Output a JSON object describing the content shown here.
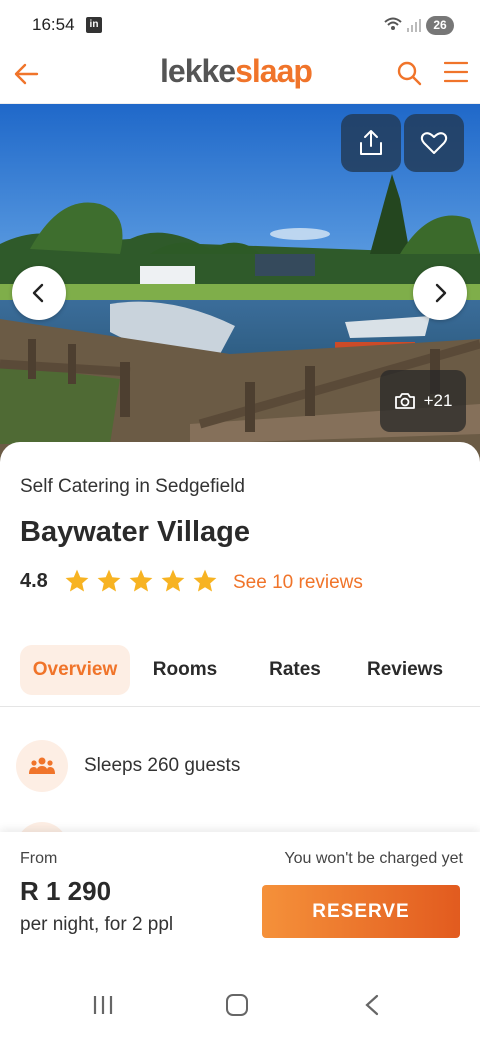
{
  "status_bar": {
    "time": "16:54",
    "notification_icon": "linkedin-icon",
    "battery": "26"
  },
  "header": {
    "logo_part1": "lekke",
    "logo_part2": "slaap",
    "back_icon": "arrow-left-icon",
    "search_icon": "search-icon",
    "menu_icon": "hamburger-menu-icon"
  },
  "hero": {
    "photo_count": "+21",
    "share_icon": "share-icon",
    "favorite_icon": "heart-icon"
  },
  "listing": {
    "category": "Self Catering in Sedgefield",
    "title": "Baywater Village",
    "rating": "4.8",
    "stars": 5,
    "reviews_link": "See 10 reviews"
  },
  "tabs": [
    {
      "label": "Overview",
      "active": true
    },
    {
      "label": "Rooms",
      "active": false
    },
    {
      "label": "Rates",
      "active": false
    },
    {
      "label": "Reviews",
      "active": false
    }
  ],
  "features": [
    {
      "icon": "people-icon",
      "label": "Sleeps 260 guests"
    }
  ],
  "booking": {
    "from_label": "From",
    "price": "R 1 290",
    "per_night": "per night, for 2 ppl",
    "not_charged": "You won't be charged yet",
    "reserve_label": "RESERVE"
  },
  "colors": {
    "accent": "#f0742a",
    "accent_light": "#fdeee4",
    "overlay_button": "#223c5a"
  }
}
